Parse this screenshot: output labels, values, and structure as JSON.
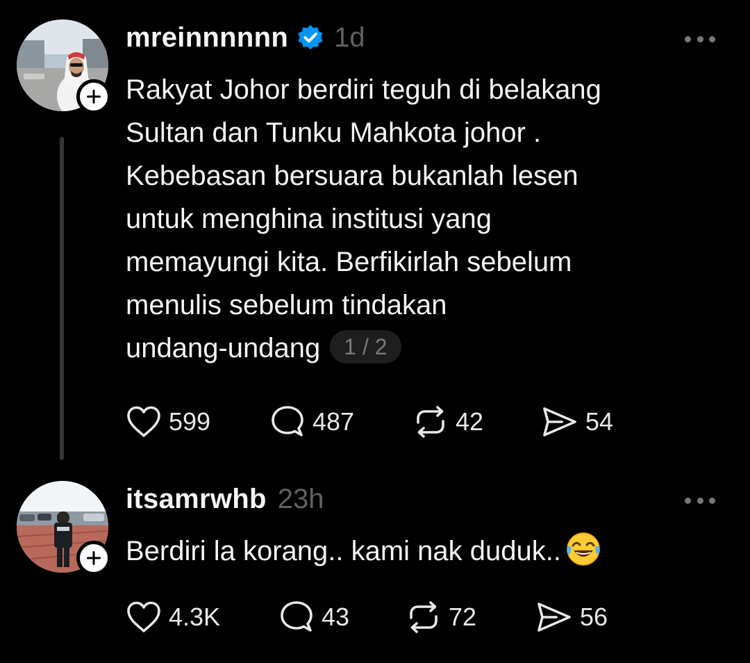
{
  "posts": [
    {
      "username": "mreinnnnnn",
      "verified": true,
      "timestamp": "1d",
      "text": "Rakyat Johor berdiri teguh di belakang\nSultan dan Tunku Mahkota johor .\nKebebasan bersuara bukanlah lesen\nuntuk menghina institusi yang\nmemayungi kita. Berfikirlah sebelum\nmenulis sebelum tindakan\nundang-undang",
      "page_indicator": "1 / 2",
      "likes": "599",
      "replies": "487",
      "reposts": "42",
      "shares": "54"
    },
    {
      "username": "itsamrwhb",
      "timestamp": "23h",
      "text": "Berdiri la korang.. kami nak duduk..",
      "emoji": "😂",
      "likes": "4.3K",
      "replies": "43",
      "reposts": "72",
      "shares": "56"
    }
  ],
  "icons": {
    "verified": "verified-badge-icon",
    "like": "heart-icon",
    "reply": "comment-bubble-icon",
    "repost": "repost-icon",
    "share": "send-icon",
    "more": "more-dots-icon",
    "follow": "plus-icon",
    "emoji": "tears-of-joy-emoji"
  },
  "colors": {
    "background": "#000000",
    "text": "#f3f5f7",
    "muted": "#616161",
    "verified": "#0095f6",
    "thread_line": "#333638"
  }
}
